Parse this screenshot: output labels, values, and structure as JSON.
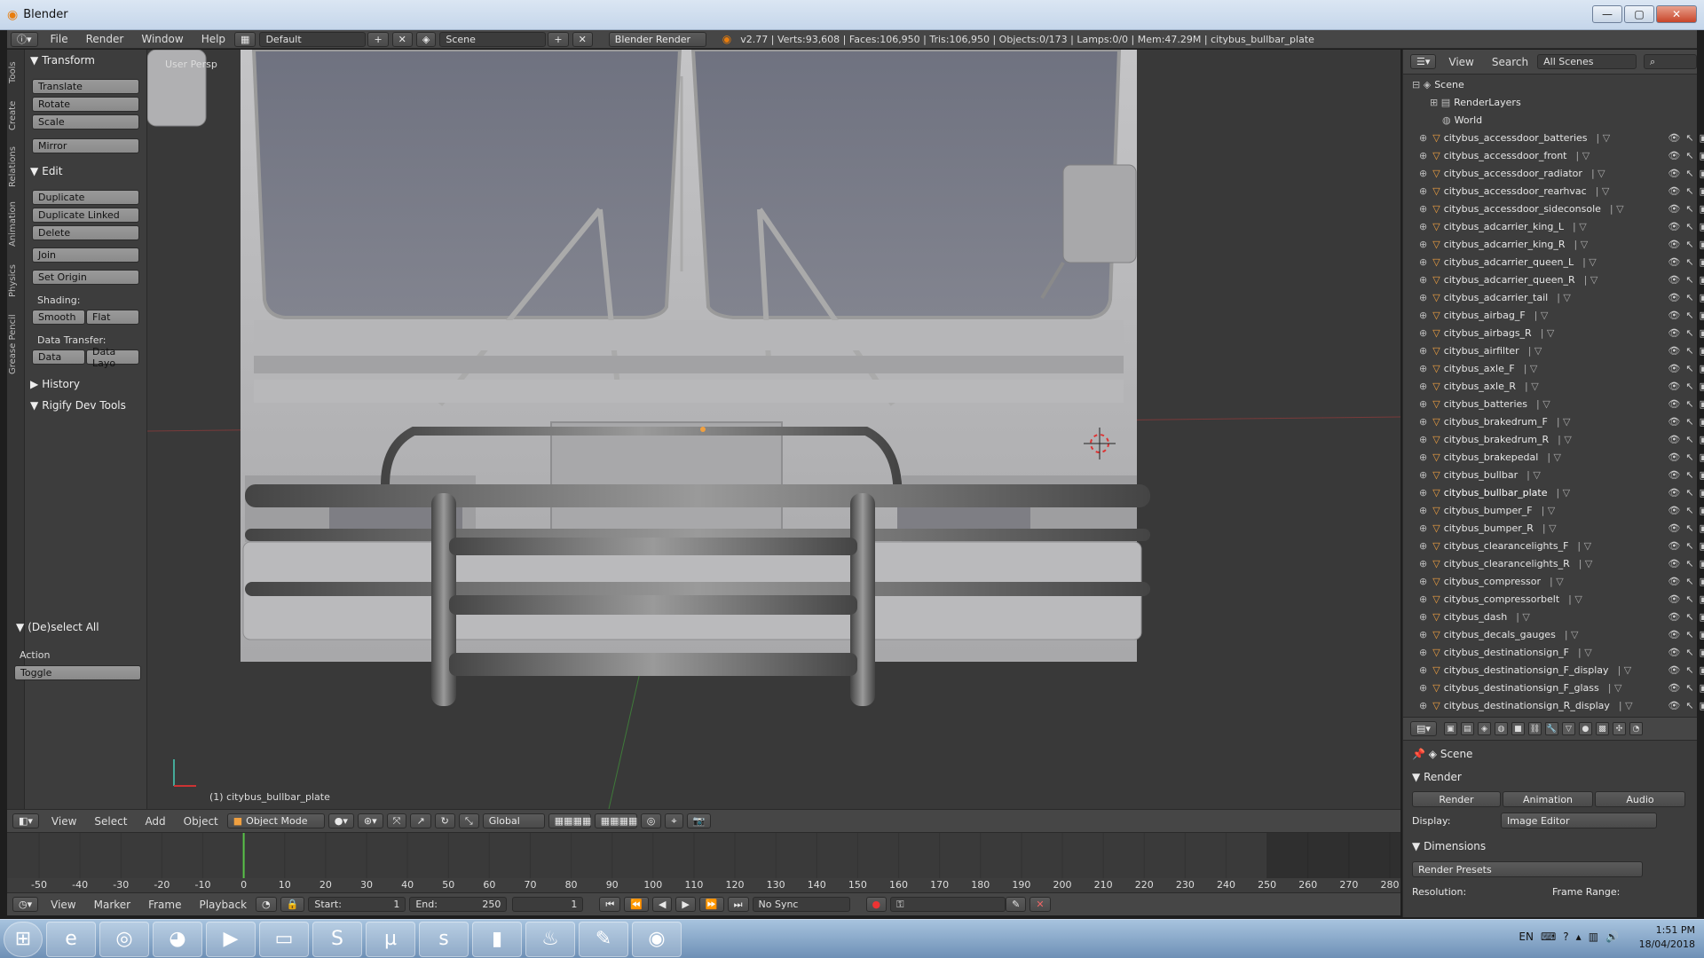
{
  "window": {
    "title": "Blender"
  },
  "info_bar": {
    "menus": [
      "File",
      "Render",
      "Window",
      "Help"
    ],
    "layout": "Default",
    "scene": "Scene",
    "engine": "Blender Render",
    "stats": "v2.77 | Verts:93,608 | Faces:106,950 | Tris:106,950 | Objects:0/173 | Lamps:0/0 | Mem:47.29M | citybus_bullbar_plate"
  },
  "tool_tabs": [
    "Tools",
    "Create",
    "Relations",
    "Animation",
    "Physics",
    "Grease Pencil"
  ],
  "tools": {
    "transform_title": "Transform",
    "translate": "Translate",
    "rotate": "Rotate",
    "scale": "Scale",
    "mirror": "Mirror",
    "edit_title": "Edit",
    "duplicate": "Duplicate",
    "duplicate_linked": "Duplicate Linked",
    "delete": "Delete",
    "join": "Join",
    "set_origin": "Set Origin",
    "shading_label": "Shading:",
    "smooth": "Smooth",
    "flat": "Flat",
    "data_transfer_label": "Data Transfer:",
    "data": "Data",
    "data_layout": "Data Layo",
    "history_title": "History",
    "rigify_title": "Rigify Dev Tools",
    "deselect_title": "(De)select All",
    "action_label": "Action",
    "action_value": "Toggle"
  },
  "viewport": {
    "persp_label": "User Persp",
    "object_label": "(1) citybus_bullbar_plate"
  },
  "viewport_header": {
    "menus": [
      "View",
      "Select",
      "Add",
      "Object"
    ],
    "mode": "Object Mode",
    "orientation": "Global"
  },
  "timeline": {
    "ticks": [
      "-50",
      "-40",
      "-30",
      "-20",
      "-10",
      "0",
      "10",
      "20",
      "30",
      "40",
      "50",
      "60",
      "70",
      "80",
      "90",
      "100",
      "110",
      "120",
      "130",
      "140",
      "150",
      "160",
      "170",
      "180",
      "190",
      "200",
      "210",
      "220",
      "230",
      "240",
      "250",
      "260",
      "270",
      "280"
    ],
    "current_frame_value": 0,
    "menus": [
      "View",
      "Marker",
      "Frame",
      "Playback"
    ],
    "start_label": "Start:",
    "start_value": "1",
    "end_label": "End:",
    "end_value": "250",
    "current": "1",
    "sync": "No Sync"
  },
  "outliner": {
    "header": {
      "view": "View",
      "search": "Search",
      "filter": "All Scenes"
    },
    "scene": "Scene",
    "render_layers": "RenderLayers",
    "world": "World",
    "items": [
      "citybus_accessdoor_batteries",
      "citybus_accessdoor_front",
      "citybus_accessdoor_radiator",
      "citybus_accessdoor_rearhvac",
      "citybus_accessdoor_sideconsole",
      "citybus_adcarrier_king_L",
      "citybus_adcarrier_king_R",
      "citybus_adcarrier_queen_L",
      "citybus_adcarrier_queen_R",
      "citybus_adcarrier_tail",
      "citybus_airbag_F",
      "citybus_airbags_R",
      "citybus_airfilter",
      "citybus_axle_F",
      "citybus_axle_R",
      "citybus_batteries",
      "citybus_brakedrum_F",
      "citybus_brakedrum_R",
      "citybus_brakepedal",
      "citybus_bullbar",
      "citybus_bullbar_plate",
      "citybus_bumper_F",
      "citybus_bumper_R",
      "citybus_clearancelights_F",
      "citybus_clearancelights_R",
      "citybus_compressor",
      "citybus_compressorbelt",
      "citybus_dash",
      "citybus_decals_gauges",
      "citybus_destinationsign_F",
      "citybus_destinationsign_F_display",
      "citybus_destinationsign_F_glass",
      "citybus_destinationsign_R_display"
    ],
    "selected": "citybus_bullbar_plate"
  },
  "properties": {
    "scene": "Scene",
    "render_title": "Render",
    "render_btn": "Render",
    "animation_btn": "Animation",
    "audio_btn": "Audio",
    "display_label": "Display:",
    "display_value": "Image Editor",
    "dimensions_title": "Dimensions",
    "presets": "Render Presets",
    "resolution_label": "Resolution:",
    "frame_range_label": "Frame Range:"
  },
  "taskbar": {
    "apps": [
      "windows-start-icon",
      "internet-explorer-icon",
      "chrome-icon",
      "firefox-icon",
      "media-player-icon",
      "file-explorer-icon",
      "sublime-icon",
      "utorrent-icon",
      "skype-icon",
      "archive-icon",
      "steam-icon",
      "paint-icon",
      "blender-icon"
    ],
    "lang": "EN",
    "time": "1:51 PM",
    "date": "18/04/2018"
  },
  "colors": {
    "accent": "#f0a040",
    "selected_text": "#ffffff",
    "viewport_bg": "#393939"
  }
}
